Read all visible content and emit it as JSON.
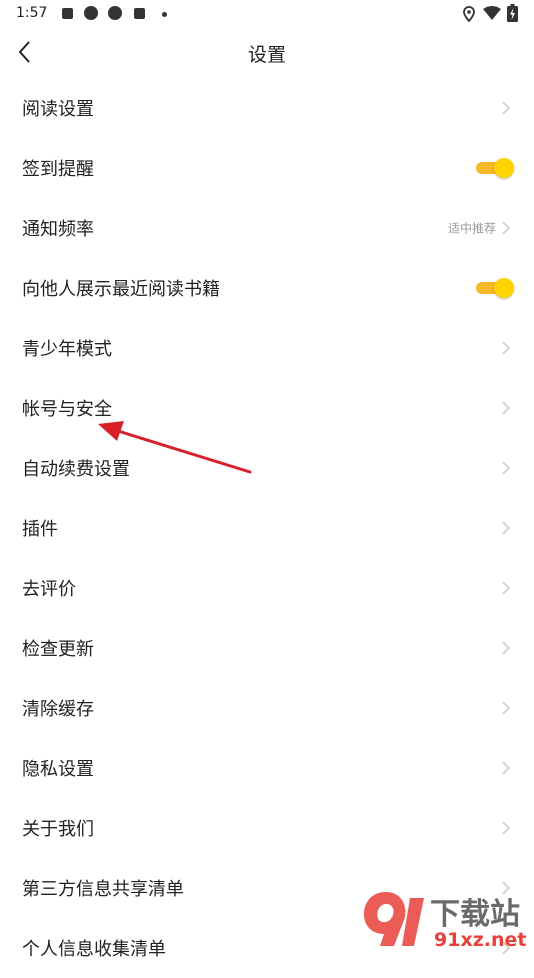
{
  "status_bar": {
    "time": "1:57",
    "left_icons": [
      "stop-square-icon",
      "aperture-icon",
      "aperture-icon",
      "stop-square-icon",
      "dot-icon"
    ],
    "right_icons": [
      "location-icon",
      "wifi-icon",
      "battery-charging-icon"
    ]
  },
  "header": {
    "back_icon": "chevron-left-icon",
    "title": "设置"
  },
  "colors": {
    "toggle_track": "#f5b825",
    "toggle_knob": "#ffd200",
    "chevron": "#c8c8c8",
    "annotation_arrow": "#d8202a"
  },
  "settings": {
    "items": [
      {
        "label": "阅读设置",
        "type": "nav"
      },
      {
        "label": "签到提醒",
        "type": "toggle",
        "on": true
      },
      {
        "label": "通知频率",
        "type": "nav",
        "value": "适中推荐"
      },
      {
        "label": "向他人展示最近阅读书籍",
        "type": "toggle",
        "on": true
      },
      {
        "label": "青少年模式",
        "type": "nav"
      },
      {
        "label": "帐号与安全",
        "type": "nav"
      },
      {
        "label": "自动续费设置",
        "type": "nav"
      },
      {
        "label": "插件",
        "type": "nav"
      },
      {
        "label": "去评价",
        "type": "nav"
      },
      {
        "label": "检查更新",
        "type": "nav"
      },
      {
        "label": "清除缓存",
        "type": "nav"
      },
      {
        "label": "隐私设置",
        "type": "nav"
      },
      {
        "label": "关于我们",
        "type": "nav"
      },
      {
        "label": "第三方信息共享清单",
        "type": "nav"
      },
      {
        "label": "个人信息收集清单",
        "type": "nav"
      }
    ]
  },
  "watermark": {
    "logo_text": "下载站",
    "domain": "91xz.net"
  }
}
